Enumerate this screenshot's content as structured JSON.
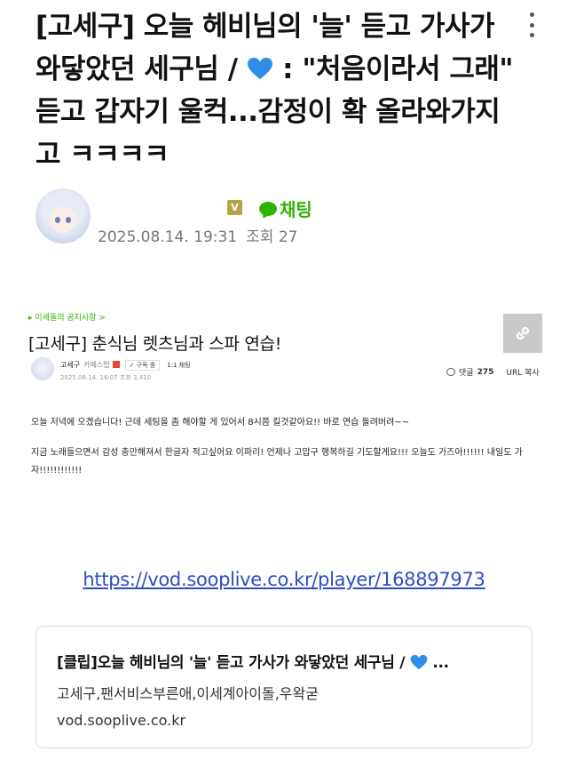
{
  "post": {
    "title": "[고세구] 오늘 헤비님의 '늘' 듣고 가사가 와닿았던 세구님 / ",
    "title_after_heart": " : \"처음이라서 그래\" 듣고 갑자기 울컥...감정이 확 올라와가지고 ㅋㅋㅋㅋ",
    "author_badge": "V",
    "chat_label": "채팅",
    "date": "2025.08.14. 19:31",
    "views": "조회 27"
  },
  "embed": {
    "notice_link": "▸ 이세돌의 공지사항 >",
    "title": "[고세구] 춘식님 렛츠님과 스파 연습!",
    "author": "고세구",
    "author_level": "카페스탭",
    "subscribe_label": "✓ 구독 중",
    "chat_label": "1:1 채팅",
    "date": "2025.08.14. 16:07",
    "views": "조회 3,410",
    "comment_label": "댓글",
    "comment_count": "275",
    "url_copy_label": "URL 복사",
    "body": [
      "오늘 저녁에 오겠습니다! 근데 세팅을 좀 해야할 게 있어서 8시쯤 킬것같아요!! 바로 연습 돌려버려~~",
      "지금 노래들으면서 감성 충만해져서 한글자 적고싶어요 이파리! 언제나 고맙구 행복하길 기도할게요!!! 오늘도 가즈아!!!!!! 내일도 가자!!!!!!!!!!!!"
    ]
  },
  "vod_link": "https://vod.sooplive.co.kr/player/168897973",
  "link_card": {
    "title": "[클립]오늘 헤비님의 '늘' 듣고 가사가 와닿았던 세구님 / ",
    "title_suffix": " ...",
    "description": "고세구,팬서비스부른애,이세계아이돌,우왁굳",
    "domain": "vod.sooplive.co.kr"
  },
  "colors": {
    "chat_green": "#2db400",
    "link_blue": "#2b4fc2",
    "heart_blue": "#2f8ee8",
    "badge_gold": "#b9a244"
  },
  "icons": {
    "more": "kebab-menu-icon",
    "heart": "blue-heart-icon",
    "chat": "chat-bubble-icon",
    "share": "link-share-icon",
    "comment": "comment-icon"
  }
}
